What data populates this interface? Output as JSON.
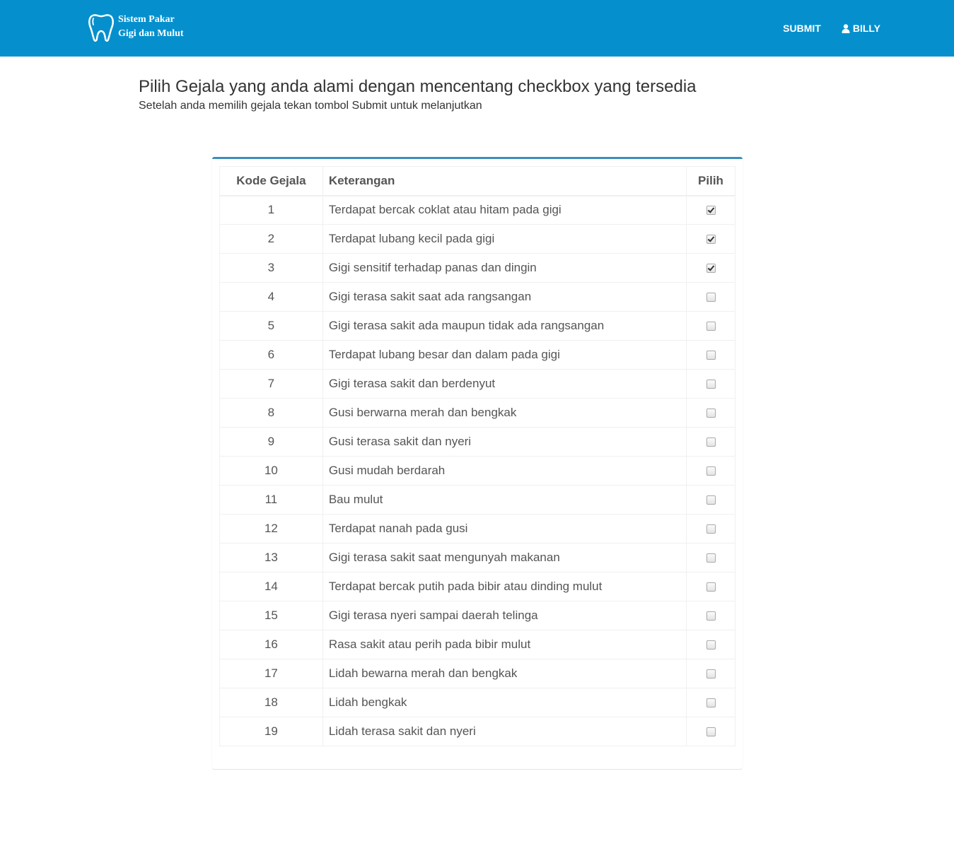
{
  "navbar": {
    "brand_line1": "Sistem Pakar",
    "brand_line2": "Gigi dan Mulut",
    "submit_label": "SUBMIT",
    "user_label": "BILLY",
    "user_icon": "user-icon",
    "brand_icon": "tooth-icon",
    "bg_color": "#0590cd"
  },
  "heading": {
    "title": "Pilih Gejala yang anda alami dengan mencentang checkbox yang tersedia",
    "subtitle": "Setelah anda memilih gejala tekan tombol Submit untuk melanjutkan"
  },
  "table": {
    "headers": {
      "kode": "Kode Gejala",
      "keterangan": "Keterangan",
      "pilih": "Pilih"
    },
    "rows": [
      {
        "kode": "1",
        "keterangan": "Terdapat bercak coklat atau hitam pada gigi",
        "checked": true
      },
      {
        "kode": "2",
        "keterangan": "Terdapat lubang kecil pada gigi",
        "checked": true
      },
      {
        "kode": "3",
        "keterangan": "Gigi sensitif terhadap panas dan dingin",
        "checked": true
      },
      {
        "kode": "4",
        "keterangan": "Gigi terasa sakit saat ada rangsangan",
        "checked": false
      },
      {
        "kode": "5",
        "keterangan": "Gigi terasa sakit ada maupun tidak ada rangsangan",
        "checked": false
      },
      {
        "kode": "6",
        "keterangan": "Terdapat lubang besar dan dalam pada gigi",
        "checked": false
      },
      {
        "kode": "7",
        "keterangan": "Gigi terasa sakit dan berdenyut",
        "checked": false
      },
      {
        "kode": "8",
        "keterangan": "Gusi berwarna merah dan bengkak",
        "checked": false
      },
      {
        "kode": "9",
        "keterangan": "Gusi terasa sakit dan nyeri",
        "checked": false
      },
      {
        "kode": "10",
        "keterangan": "Gusi mudah berdarah",
        "checked": false
      },
      {
        "kode": "11",
        "keterangan": "Bau mulut",
        "checked": false
      },
      {
        "kode": "12",
        "keterangan": "Terdapat nanah pada gusi",
        "checked": false
      },
      {
        "kode": "13",
        "keterangan": "Gigi terasa sakit saat mengunyah makanan",
        "checked": false
      },
      {
        "kode": "14",
        "keterangan": "Terdapat bercak putih pada bibir atau dinding mulut",
        "checked": false
      },
      {
        "kode": "15",
        "keterangan": "Gigi terasa nyeri sampai daerah telinga",
        "checked": false
      },
      {
        "kode": "16",
        "keterangan": "Rasa sakit atau perih pada bibir mulut",
        "checked": false
      },
      {
        "kode": "17",
        "keterangan": "Lidah bewarna merah dan bengkak",
        "checked": false
      },
      {
        "kode": "18",
        "keterangan": "Lidah bengkak",
        "checked": false
      },
      {
        "kode": "19",
        "keterangan": "Lidah terasa sakit dan nyeri",
        "checked": false
      }
    ]
  }
}
